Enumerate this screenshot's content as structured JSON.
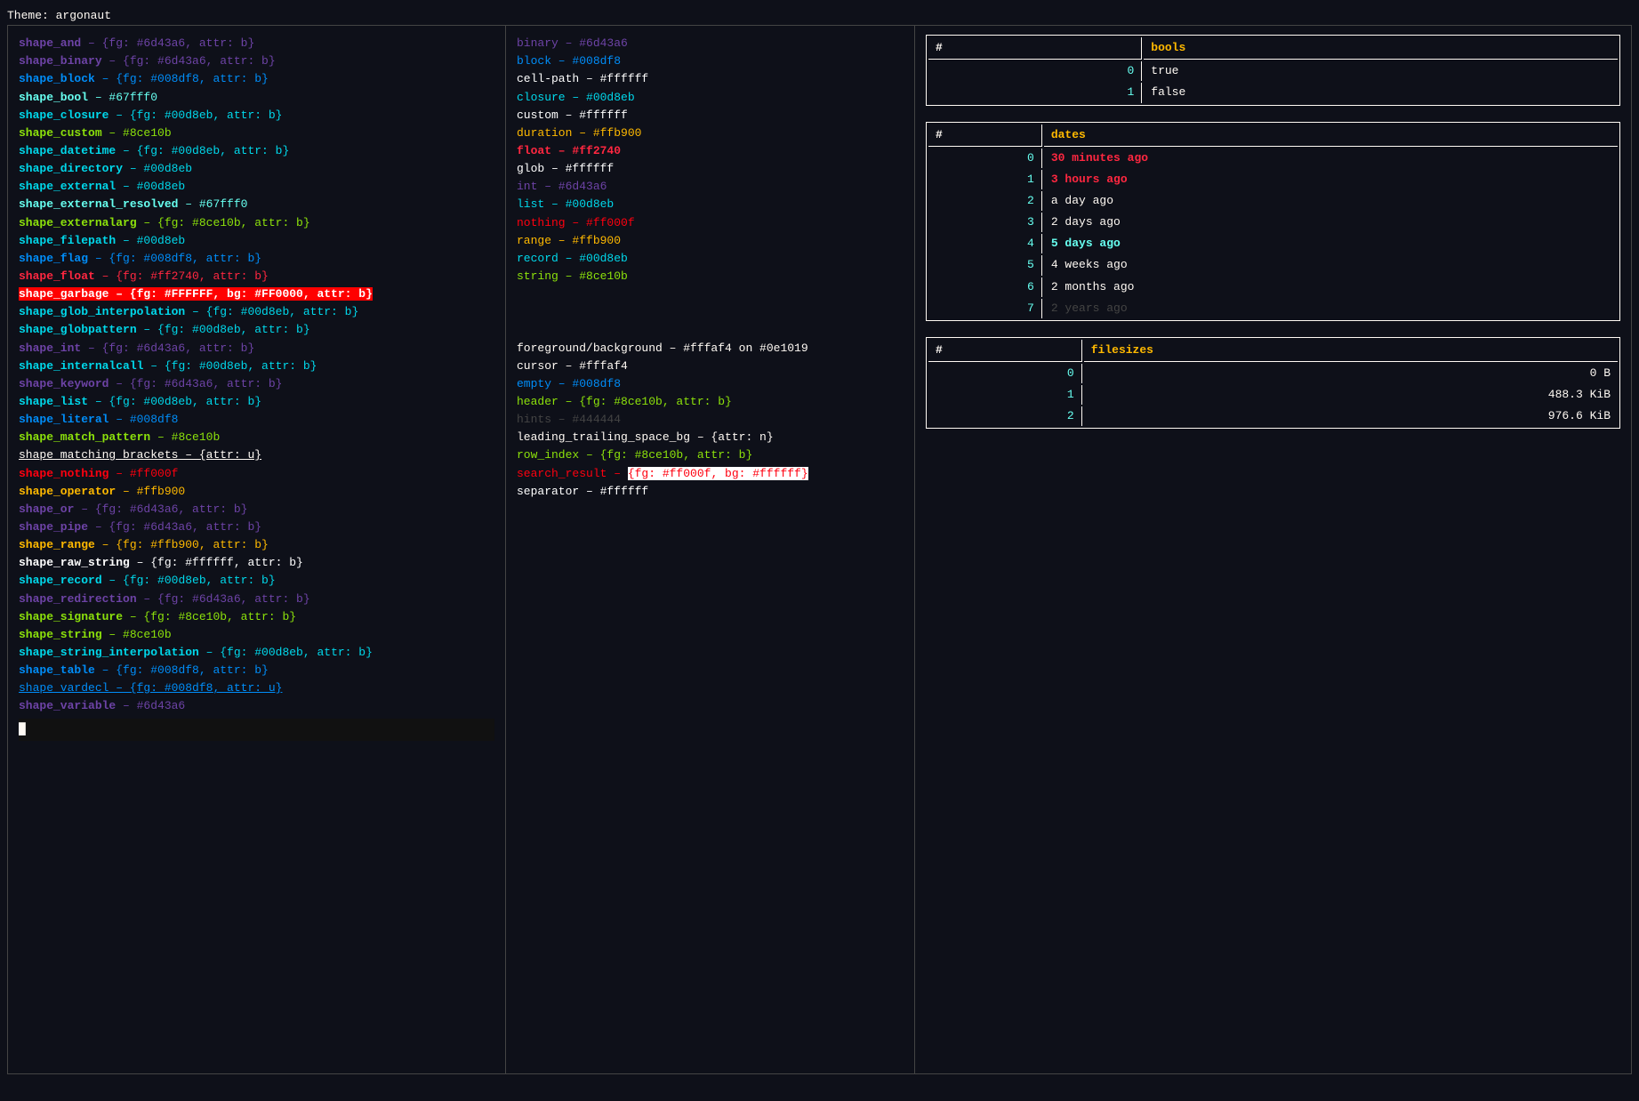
{
  "theme_header": "Theme: argonaut",
  "col_left": {
    "lines": [
      {
        "text": "shape_and – {fg: #6d43a6, attr: b}",
        "parts": [
          {
            "t": "shape_and",
            "c": "c-muted bold"
          },
          {
            "t": " – {fg: #6d43a6, attr: b}",
            "c": "c-muted"
          }
        ]
      },
      {
        "text": "shape_binary – {fg: #6d43a6, attr: b}",
        "parts": [
          {
            "t": "shape_binary",
            "c": "c-muted bold"
          },
          {
            "t": " – {fg: #6d43a6, attr: b}",
            "c": "c-muted"
          }
        ]
      },
      {
        "text": "shape_block – {fg: #008df8, attr: b}",
        "parts": [
          {
            "t": "shape_block",
            "c": "c-blue bold"
          },
          {
            "t": " – {fg: #008df8, attr: b}",
            "c": "c-blue"
          }
        ]
      },
      {
        "text": "shape_bool – #67fff0",
        "parts": [
          {
            "t": "shape_bool",
            "c": "c-green bold"
          },
          {
            "t": " – #67fff0",
            "c": "c-green"
          }
        ]
      },
      {
        "text": "shape_closure – {fg: #00d8eb, attr: b}",
        "parts": [
          {
            "t": "shape_closure",
            "c": "c-teal bold"
          },
          {
            "t": " – {fg: #00d8eb, attr: b}",
            "c": "c-teal"
          }
        ]
      },
      {
        "text": "shape_custom – #8ce10b",
        "parts": [
          {
            "t": "shape_custom",
            "c": "c-purple bold"
          },
          {
            "t": " – #8ce10b",
            "c": "c-purple"
          }
        ]
      },
      {
        "text": "shape_datetime – {fg: #00d8eb, attr: b}",
        "parts": [
          {
            "t": "shape_datetime",
            "c": "c-teal bold"
          },
          {
            "t": " – {fg: #00d8eb, attr: b}",
            "c": "c-teal"
          }
        ]
      },
      {
        "text": "shape_directory – #00d8eb",
        "parts": [
          {
            "t": "shape_directory",
            "c": "c-teal bold"
          },
          {
            "t": " – #00d8eb",
            "c": "c-teal"
          }
        ]
      },
      {
        "text": "shape_external – #00d8eb",
        "parts": [
          {
            "t": "shape_external",
            "c": "c-teal bold"
          },
          {
            "t": " – #00d8eb",
            "c": "c-teal"
          }
        ]
      },
      {
        "text": "shape_external_resolved – #67fff0",
        "parts": [
          {
            "t": "shape_external_resolved",
            "c": "c-green bold"
          },
          {
            "t": " – #67fff0",
            "c": "c-green"
          }
        ]
      },
      {
        "text": "shape_externalarg – {fg: #8ce10b, attr: b}",
        "parts": [
          {
            "t": "shape_externalarg",
            "c": "c-purple bold"
          },
          {
            "t": " – {fg: #8ce10b, attr: b}",
            "c": "c-purple"
          }
        ]
      },
      {
        "text": "shape_filepath – #00d8eb",
        "parts": [
          {
            "t": "shape_filepath",
            "c": "c-teal bold"
          },
          {
            "t": " – #00d8eb",
            "c": "c-teal"
          }
        ]
      },
      {
        "text": "shape_flag – {fg: #008df8, attr: b}",
        "parts": [
          {
            "t": "shape_flag",
            "c": "c-blue bold"
          },
          {
            "t": " – {fg: #008df8, attr: b}",
            "c": "c-blue"
          }
        ]
      },
      {
        "text": "shape_float – {fg: #ff2740, attr: b}",
        "highlight": "pink",
        "parts": [
          {
            "t": "shape_float",
            "c": "c-pink bold"
          },
          {
            "t": " – {fg: #ff2740, attr: b}",
            "c": "c-pink"
          }
        ]
      },
      {
        "text": "shape_garbage – {fg: #FFFFFF, bg: #FF0000, attr: b}",
        "highlight": "red-bg",
        "parts": [
          {
            "t": "shape_garbage – {fg: #FFFFFF, bg: #FF0000, attr: b}",
            "c": "highlight-red"
          }
        ]
      },
      {
        "text": "shape_glob_interpolation – {fg: #00d8eb, attr: b}",
        "parts": [
          {
            "t": "shape_glob_interpolation",
            "c": "c-teal bold"
          },
          {
            "t": " – {fg: #00d8eb, attr: b}",
            "c": "c-teal"
          }
        ]
      },
      {
        "text": "shape_globpattern – {fg: #00d8eb, attr: b}",
        "parts": [
          {
            "t": "shape_globpattern",
            "c": "c-teal bold"
          },
          {
            "t": " – {fg: #00d8eb, attr: b}",
            "c": "c-teal"
          }
        ]
      },
      {
        "text": "shape_int – {fg: #6d43a6, attr: b}",
        "parts": [
          {
            "t": "shape_int",
            "c": "c-muted bold"
          },
          {
            "t": " – {fg: #6d43a6, attr: b}",
            "c": "c-muted"
          }
        ]
      },
      {
        "text": "shape_internalcall – {fg: #00d8eb, attr: b}",
        "parts": [
          {
            "t": "shape_internalcall",
            "c": "c-teal bold"
          },
          {
            "t": " – {fg: #00d8eb, attr: b}",
            "c": "c-teal"
          }
        ]
      },
      {
        "text": "shape_keyword – {fg: #6d43a6, attr: b}",
        "parts": [
          {
            "t": "shape_keyword",
            "c": "c-muted bold"
          },
          {
            "t": " – {fg: #6d43a6, attr: b}",
            "c": "c-muted"
          }
        ]
      },
      {
        "text": "shape_list – {fg: #00d8eb, attr: b}",
        "parts": [
          {
            "t": "shape_list",
            "c": "c-teal bold"
          },
          {
            "t": " – {fg: #00d8eb, attr: b}",
            "c": "c-teal"
          }
        ]
      },
      {
        "text": "shape_literal – #008df8",
        "parts": [
          {
            "t": "shape_literal",
            "c": "c-blue bold"
          },
          {
            "t": " – #008df8",
            "c": "c-blue"
          }
        ]
      },
      {
        "text": "shape_match_pattern – #8ce10b",
        "parts": [
          {
            "t": "shape_match_pattern",
            "c": "c-purple bold"
          },
          {
            "t": " – #8ce10b",
            "c": "c-purple"
          }
        ]
      },
      {
        "text": "shape_matching_brackets – {attr: u}",
        "underline": true,
        "parts": [
          {
            "t": "shape_matching_brackets",
            "c": "c-default underline"
          },
          {
            "t": " – {attr: u}",
            "c": "c-default underline"
          }
        ]
      },
      {
        "text": "shape_nothing – #ff000f",
        "parts": [
          {
            "t": "shape_nothing",
            "c": "c-red bold"
          },
          {
            "t": " – #ff000f",
            "c": "c-red"
          }
        ]
      },
      {
        "text": "shape_operator – #ffb900",
        "parts": [
          {
            "t": "shape_operator",
            "c": "c-orange bold"
          },
          {
            "t": " – #ffb900",
            "c": "c-orange"
          }
        ]
      },
      {
        "text": "shape_or – {fg: #6d43a6, attr: b}",
        "parts": [
          {
            "t": "shape_or",
            "c": "c-muted bold"
          },
          {
            "t": " – {fg: #6d43a6, attr: b}",
            "c": "c-muted"
          }
        ]
      },
      {
        "text": "shape_pipe – {fg: #6d43a6, attr: b}",
        "parts": [
          {
            "t": "shape_pipe",
            "c": "c-muted bold"
          },
          {
            "t": " – {fg: #6d43a6, attr: b}",
            "c": "c-muted"
          }
        ]
      },
      {
        "text": "shape_range – {fg: #ffb900, attr: b}",
        "parts": [
          {
            "t": "shape_range",
            "c": "c-orange bold"
          },
          {
            "t": " – {fg: #ffb900, attr: b}",
            "c": "c-orange"
          }
        ]
      },
      {
        "text": "shape_raw_string – {fg: #ffffff, attr: b}",
        "parts": [
          {
            "t": "shape_raw_string",
            "c": "c-white bold"
          },
          {
            "t": " – {fg: #ffffff, attr: b}",
            "c": "c-white"
          }
        ]
      },
      {
        "text": "shape_record – {fg: #00d8eb, attr: b}",
        "parts": [
          {
            "t": "shape_record",
            "c": "c-teal bold"
          },
          {
            "t": " – {fg: #00d8eb, attr: b}",
            "c": "c-teal"
          }
        ]
      },
      {
        "text": "shape_redirection – {fg: #6d43a6, attr: b}",
        "parts": [
          {
            "t": "shape_redirection",
            "c": "c-muted bold"
          },
          {
            "t": " – {fg: #6d43a6, attr: b}",
            "c": "c-muted"
          }
        ]
      },
      {
        "text": "shape_signature – {fg: #8ce10b, attr: b}",
        "parts": [
          {
            "t": "shape_signature",
            "c": "c-purple bold"
          },
          {
            "t": " – {fg: #8ce10b, attr: b}",
            "c": "c-purple"
          }
        ]
      },
      {
        "text": "shape_string – #8ce10b",
        "parts": [
          {
            "t": "shape_string",
            "c": "c-purple bold"
          },
          {
            "t": " – #8ce10b",
            "c": "c-purple"
          }
        ]
      },
      {
        "text": "shape_string_interpolation – {fg: #00d8eb, attr: b}",
        "parts": [
          {
            "t": "shape_string_interpolation",
            "c": "c-teal bold"
          },
          {
            "t": " – {fg: #00d8eb, attr: b}",
            "c": "c-teal"
          }
        ]
      },
      {
        "text": "shape_table – {fg: #008df8, attr: b}",
        "parts": [
          {
            "t": "shape_table",
            "c": "c-blue bold"
          },
          {
            "t": " – {fg: #008df8, attr: b}",
            "c": "c-blue"
          }
        ]
      },
      {
        "text": "shape_vardecl – {fg: #008df8, attr: u}",
        "underline": true,
        "parts": [
          {
            "t": "shape_vardecl",
            "c": "c-blue underline"
          },
          {
            "t": " – {fg: #008df8, attr: u}",
            "c": "c-blue underline"
          }
        ]
      },
      {
        "text": "shape_variable – #6d43a6",
        "parts": [
          {
            "t": "shape_variable",
            "c": "c-muted bold"
          },
          {
            "t": " – #6d43a6",
            "c": "c-muted"
          }
        ]
      }
    ]
  },
  "col_mid": {
    "top_lines": [
      {
        "key": "binary",
        "key_c": "c-muted",
        "sep": " – ",
        "val": "#6d43a6",
        "val_c": "c-muted"
      },
      {
        "key": "block",
        "key_c": "c-blue",
        "sep": " – ",
        "val": "#008df8",
        "val_c": "c-blue"
      },
      {
        "key": "cell-path",
        "key_c": "c-white",
        "sep": " – ",
        "val": "#ffffff",
        "val_c": "c-white"
      },
      {
        "key": "closure",
        "key_c": "c-teal",
        "sep": " – ",
        "val": "#00d8eb",
        "val_c": "c-teal"
      },
      {
        "key": "custom",
        "key_c": "c-white",
        "sep": " – ",
        "val": "#ffffff",
        "val_c": "c-white"
      },
      {
        "key": "duration",
        "key_c": "c-orange",
        "sep": " – ",
        "val": "#ffb900",
        "val_c": "c-orange"
      },
      {
        "key": "float",
        "key_c": "c-pink",
        "sep": " – ",
        "val": "#ff2740",
        "val_c": "c-pink",
        "bold": true
      },
      {
        "key": "glob",
        "key_c": "c-white",
        "sep": " – ",
        "val": "#ffffff",
        "val_c": "c-white"
      },
      {
        "key": "int",
        "key_c": "c-muted",
        "sep": " – ",
        "val": "#6d43a6",
        "val_c": "c-muted"
      },
      {
        "key": "list",
        "key_c": "c-teal",
        "sep": " – ",
        "val": "#00d8eb",
        "val_c": "c-teal"
      },
      {
        "key": "nothing",
        "key_c": "c-red",
        "sep": " – ",
        "val": "#ff000f",
        "val_c": "c-red"
      },
      {
        "key": "range",
        "key_c": "c-orange",
        "sep": " – ",
        "val": "#ffb900",
        "val_c": "c-orange"
      },
      {
        "key": "record",
        "key_c": "c-teal",
        "sep": " – ",
        "val": "#00d8eb",
        "val_c": "c-teal"
      },
      {
        "key": "string",
        "key_c": "c-purple",
        "sep": " – ",
        "val": "#8ce10b",
        "val_c": "c-purple"
      }
    ],
    "bottom_lines": [
      {
        "key": "foreground/background",
        "key_c": "c-default",
        "sep": " – ",
        "val": "#fffaf4 on #0e1019",
        "val_c": "c-default"
      },
      {
        "key": "cursor",
        "key_c": "c-default",
        "sep": " – ",
        "val": "#fffaf4",
        "val_c": "c-default"
      },
      {
        "key": "empty",
        "key_c": "c-blue",
        "sep": " – ",
        "val": "#008df8",
        "val_c": "c-blue"
      },
      {
        "key": "header",
        "key_c": "c-purple",
        "sep": " – ",
        "val": "{fg: #8ce10b, attr: b}",
        "val_c": "c-purple"
      },
      {
        "key": "hints",
        "key_c": "c-dim",
        "sep": " – ",
        "val": "#444444",
        "val_c": "c-dim"
      },
      {
        "key": "leading_trailing_space_bg",
        "key_c": "c-default",
        "sep": " – ",
        "val": "{attr: n}",
        "val_c": "c-default"
      },
      {
        "key": "row_index",
        "key_c": "c-purple",
        "sep": " – ",
        "val": "{fg: #8ce10b, attr: b}",
        "val_c": "c-purple"
      },
      {
        "key": "search_result",
        "key_c": "c-red",
        "sep": " – ",
        "val": "{fg: #ff000f, bg: #ffffff}",
        "val_c": "c-red",
        "highlight": true
      },
      {
        "key": "separator",
        "key_c": "c-white",
        "sep": " – ",
        "val": "#ffffff",
        "val_c": "c-white"
      }
    ]
  },
  "col_right": {
    "bools_table": {
      "col1": "#",
      "col2": "bools",
      "rows": [
        {
          "idx": "0",
          "val": "true",
          "val_c": "c-default"
        },
        {
          "idx": "1",
          "val": "false",
          "val_c": "c-default"
        }
      ]
    },
    "dates_table": {
      "col1": "#",
      "col2": "dates",
      "rows": [
        {
          "idx": "0",
          "val": "30 minutes ago",
          "cls": "d0"
        },
        {
          "idx": "1",
          "val": "3 hours ago",
          "cls": "d1"
        },
        {
          "idx": "2",
          "val": "a day ago",
          "cls": "d2"
        },
        {
          "idx": "3",
          "val": "2 days ago",
          "cls": "d3"
        },
        {
          "idx": "4",
          "val": "5 days ago",
          "cls": "d4"
        },
        {
          "idx": "5",
          "val": "4 weeks ago",
          "cls": "d5"
        },
        {
          "idx": "6",
          "val": "2 months ago",
          "cls": "d6"
        },
        {
          "idx": "7",
          "val": "2 years ago",
          "cls": "d7"
        }
      ]
    },
    "filesizes_table": {
      "col1": "#",
      "col2": "filesizes",
      "rows": [
        {
          "idx": "0",
          "val": "0 B",
          "cls": "fs0"
        },
        {
          "idx": "1",
          "val": "488.3 KiB",
          "cls": "fs1"
        },
        {
          "idx": "2",
          "val": "976.6 KiB",
          "cls": "fs2"
        }
      ]
    }
  },
  "cursor_block": "█"
}
